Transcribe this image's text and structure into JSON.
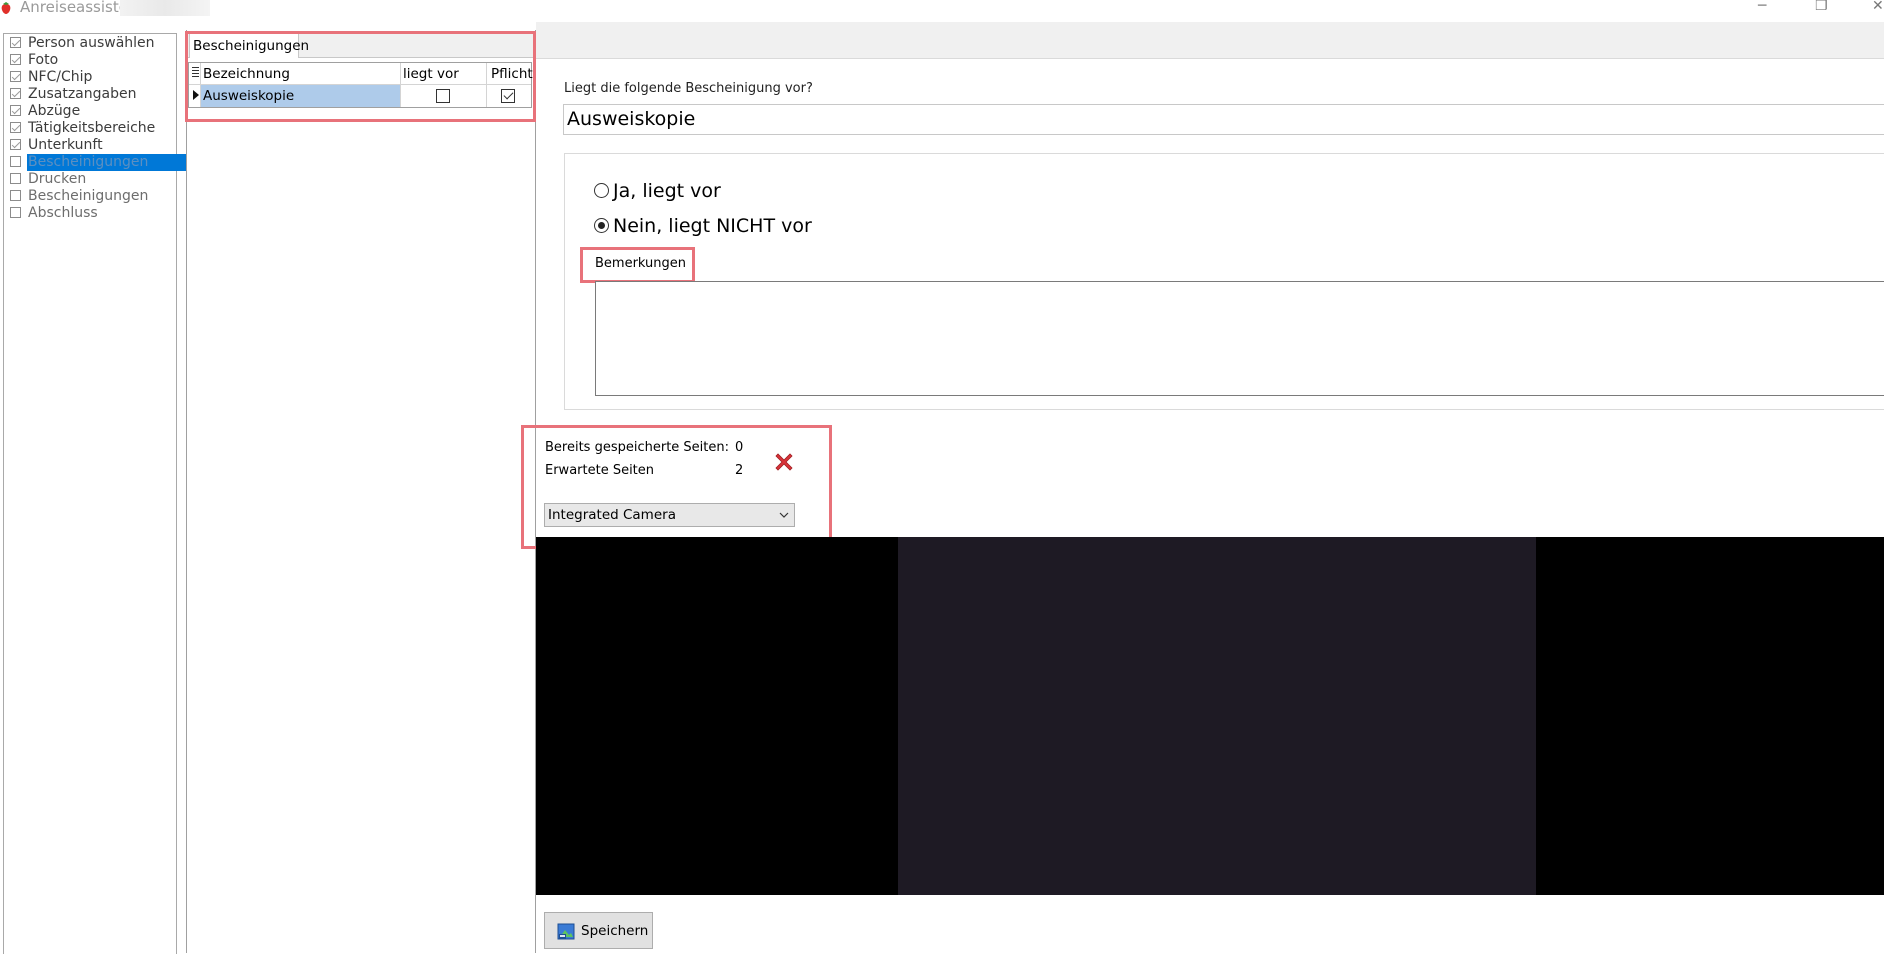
{
  "window": {
    "title": "Anreiseassisten",
    "controls": {
      "minimize": "─",
      "restore": "❐",
      "close": "✕"
    }
  },
  "steps": [
    {
      "label": "Person auswählen",
      "checked": true,
      "selected": false
    },
    {
      "label": "Foto",
      "checked": true,
      "selected": false
    },
    {
      "label": "NFC/Chip",
      "checked": true,
      "selected": false
    },
    {
      "label": "Zusatzangaben",
      "checked": true,
      "selected": false
    },
    {
      "label": "Abzüge",
      "checked": true,
      "selected": false
    },
    {
      "label": "Tätigkeitsbereiche",
      "checked": true,
      "selected": false
    },
    {
      "label": "Unterkunft",
      "checked": true,
      "selected": false
    },
    {
      "label": "Bescheinigungen",
      "checked": false,
      "selected": true
    },
    {
      "label": "Drucken",
      "checked": false,
      "selected": false
    },
    {
      "label": "Bescheinigungen",
      "checked": false,
      "selected": false
    },
    {
      "label": "Abschluss",
      "checked": false,
      "selected": false
    }
  ],
  "tab": {
    "label": "Bescheinigungen"
  },
  "grid": {
    "columns": [
      "Bezeichnung",
      "liegt vor",
      "Pflicht"
    ],
    "rows": [
      {
        "bezeichnung": "Ausweiskopie",
        "liegt_vor": false,
        "pflicht": true
      }
    ]
  },
  "question": {
    "label": "Liegt die folgende Bescheinigung vor?",
    "value": "Ausweiskopie"
  },
  "options": {
    "yes": "Ja, liegt vor",
    "no": "Nein, liegt NICHT vor",
    "selected": "no"
  },
  "remarks": {
    "label": "Bemerkungen",
    "value": ""
  },
  "pages": {
    "saved_label": "Bereits gespeicherte Seiten:",
    "saved_value": "0",
    "expected_label": "Erwartete Seiten",
    "expected_value": "2"
  },
  "camera_select": {
    "value": "Integrated Camera"
  },
  "save_button": {
    "label": "Speichern"
  },
  "colors": {
    "highlight": "#e8727a",
    "selection": "#0078d7",
    "grid_selected_row": "#aecbea",
    "delete_icon": "#d9343a"
  }
}
